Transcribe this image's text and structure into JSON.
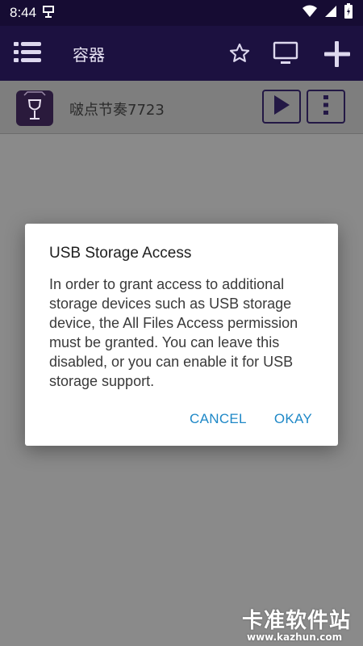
{
  "status_bar": {
    "time": "8:44"
  },
  "app_bar": {
    "title": "容器"
  },
  "container": {
    "name": "啵点节奏7723"
  },
  "dialog": {
    "title": "USB Storage Access",
    "body": "In order to grant access to additional storage devices such as USB storage device, the All Files Access permission must be granted. You can leave this disabled, or you can enable it for USB storage support.",
    "cancel_label": "CANCEL",
    "okay_label": "OKAY"
  },
  "watermark": {
    "text": "卡准软件站",
    "url": "www.kazhun.com"
  },
  "colors": {
    "status_bar_bg": "#160c33",
    "app_bar_bg": "#1c1140",
    "accent_button": "#1e88c7"
  }
}
